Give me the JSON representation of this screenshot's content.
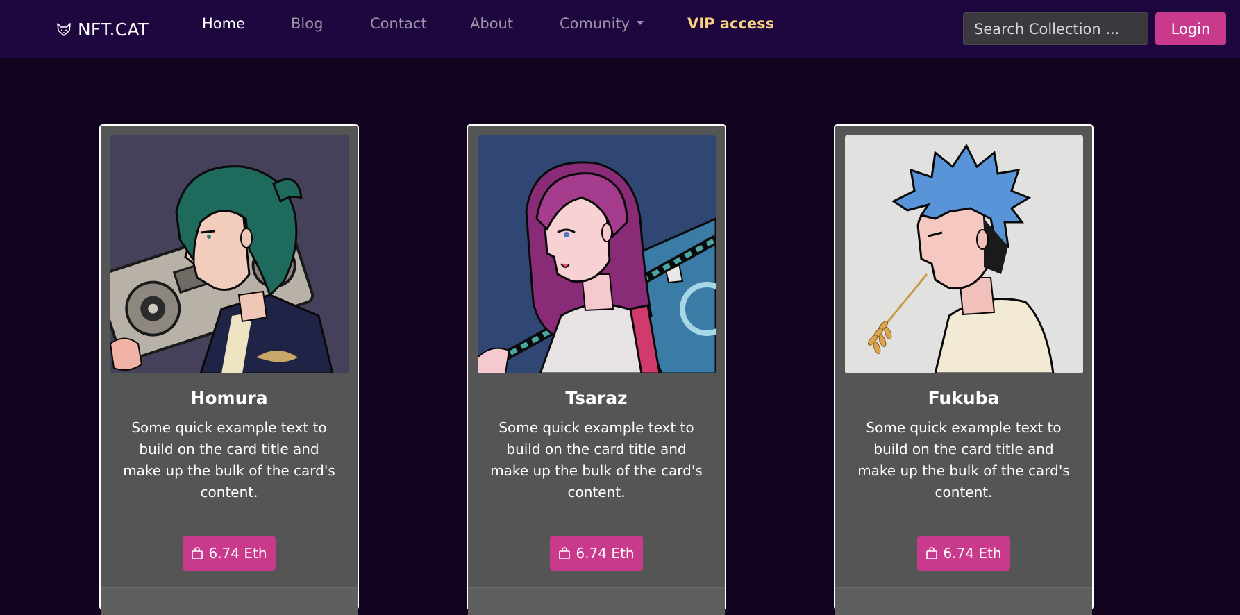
{
  "nav": {
    "brand": "NFT.CAT",
    "links": [
      "Home",
      "Blog",
      "Contact",
      "About",
      "Comunity",
      "VIP access"
    ],
    "search_placeholder": "Search Collection ...",
    "login_label": "Login"
  },
  "cards": [
    {
      "title": "Homura",
      "text": "Some quick example text to build on the card title and make up the bulk of the card's content.",
      "price": "6.74 Eth"
    },
    {
      "title": "Tsaraz",
      "text": "Some quick example text to build on the card title and make up the bulk of the card's content.",
      "price": "6.74 Eth"
    },
    {
      "title": "Fukuba",
      "text": "Some quick example text to build on the card title and make up the bulk of the card's content.",
      "price": "6.74 Eth"
    }
  ],
  "colors": {
    "page_bg": "#12031f",
    "navbar_bg": "#1e073f",
    "accent": "#c93a8d",
    "vip": "#f5d27e",
    "card_bg": "#555555"
  },
  "icons": {
    "brand": "cat-logo-icon",
    "dropdown": "caret-down-icon",
    "buy": "shopping-bag-icon"
  }
}
